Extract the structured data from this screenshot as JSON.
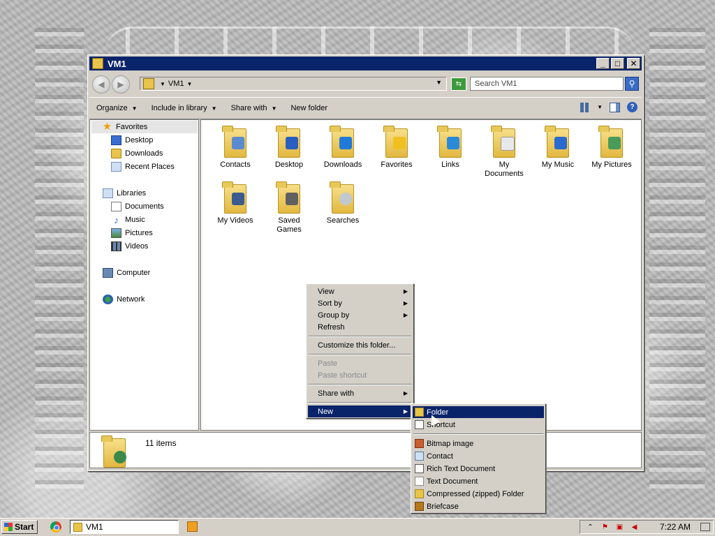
{
  "window": {
    "title": "VM1",
    "controls": {
      "minimize": "_",
      "maximize": "□",
      "close": "✕"
    }
  },
  "address": {
    "crumb": "VM1",
    "search_placeholder": "Search VM1"
  },
  "commands": {
    "organize": "Organize",
    "include_library": "Include in library",
    "share_with": "Share with",
    "new_folder": "New folder"
  },
  "nav": {
    "favorites": "Favorites",
    "desktop": "Desktop",
    "downloads": "Downloads",
    "recent_places": "Recent Places",
    "libraries": "Libraries",
    "documents": "Documents",
    "music": "Music",
    "pictures": "Pictures",
    "videos": "Videos",
    "computer": "Computer",
    "network": "Network"
  },
  "items": [
    {
      "label": "Contacts",
      "badge_color": "#5a8ad0"
    },
    {
      "label": "Desktop",
      "badge_color": "#2a5ec0"
    },
    {
      "label": "Downloads",
      "badge_color": "#1f7ad8"
    },
    {
      "label": "Favorites",
      "badge_color": "#f0c020"
    },
    {
      "label": "Links",
      "badge_color": "#2a8ad8"
    },
    {
      "label": "My Documents",
      "badge_color": "#e8e8e8"
    },
    {
      "label": "My Music",
      "badge_color": "#2a6ad0"
    },
    {
      "label": "My Pictures",
      "badge_color": "#4a9a5a"
    },
    {
      "label": "My Videos",
      "badge_color": "#3a5a90"
    },
    {
      "label": "Saved Games",
      "badge_color": "#606060"
    },
    {
      "label": "Searches",
      "badge_color": "#c0c8d0"
    }
  ],
  "details": {
    "count": "11 items"
  },
  "context_menu": {
    "view": "View",
    "sort_by": "Sort by",
    "group_by": "Group by",
    "refresh": "Refresh",
    "customize": "Customize this folder...",
    "paste": "Paste",
    "paste_shortcut": "Paste shortcut",
    "share_with": "Share with",
    "new": "New"
  },
  "new_submenu": {
    "folder": "Folder",
    "shortcut": "Shortcut",
    "bitmap": "Bitmap image",
    "contact": "Contact",
    "rtf": "Rich Text Document",
    "text": "Text Document",
    "zip": "Compressed (zipped) Folder",
    "briefcase": "Briefcase"
  },
  "taskbar": {
    "start": "Start",
    "task_vm1": "VM1",
    "clock": "7:22 AM"
  },
  "colors": {
    "titlebar": "#0a246a",
    "highlight": "#0a246a",
    "chrome": "#d4d0c8"
  }
}
